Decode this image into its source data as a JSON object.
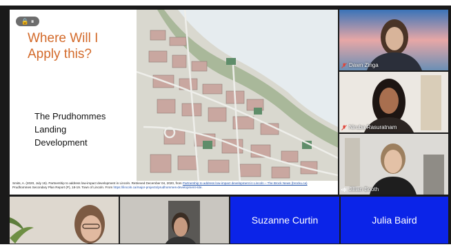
{
  "slide": {
    "lock_label": "🔒 ⏸",
    "title": "Where Will I\nApply this?",
    "subtitle": "The Prudhommes\nLanding\nDevelopment",
    "references": [
      {
        "text": "Smits, A. (2020, July 15). Partnership to address low-impact development in Lincoln. Retrieved December 04, 2020, from ",
        "link": "Partnership to address low-impact development in Lincoln – The Brock News (brocku.ca)"
      },
      {
        "text": "Prudhommes Secondary Plan Report (P), 18-19. Town of Lincoln. From ",
        "link": "https://lincoln.ca/major-projects/prudhommes-development-site."
      }
    ]
  },
  "participants": [
    {
      "name": "Dawn Zinga",
      "muted": true
    },
    {
      "name": "Niruba Rasuratnam",
      "muted": true
    },
    {
      "name": "Jillian Booth",
      "muted": false
    }
  ],
  "bottom_tiles": [
    {
      "name": "Suzanne Curtin"
    },
    {
      "name": "Julia Baird"
    }
  ],
  "colors": {
    "title_orange": "#d36a2a",
    "tile_blue": "#0b24e8",
    "muted_red": "#e0463a"
  }
}
